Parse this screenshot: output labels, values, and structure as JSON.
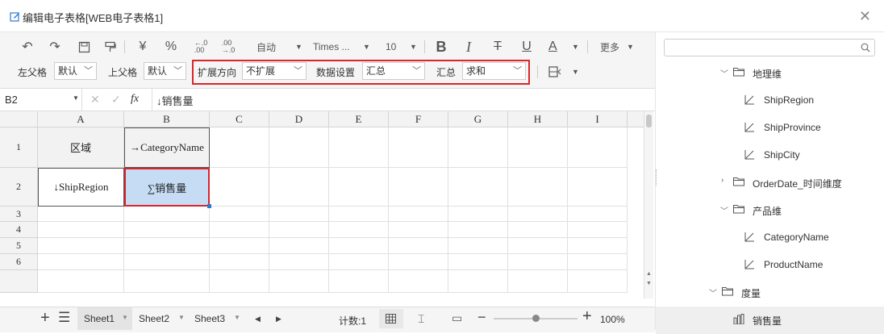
{
  "window": {
    "title": "编辑电子表格[WEB电子表格1]"
  },
  "toolbar": {
    "font_size": "10",
    "auto_label": "自动",
    "font_name": "Times ...",
    "currency": "¥",
    "percent": "%",
    "more_label": "更多",
    "left_parent_label": "左父格",
    "left_parent_value": "默认",
    "top_parent_label": "上父格",
    "top_parent_value": "默认",
    "expand_label": "扩展方向",
    "expand_value": "不扩展",
    "data_setting_label": "数据设置",
    "data_setting_value": "汇总",
    "summary_label": "汇总",
    "summary_value": "求和"
  },
  "formula_bar": {
    "cell_ref": "B2",
    "content": "↓销售量"
  },
  "grid": {
    "columns": [
      "A",
      "B",
      "C",
      "D",
      "E",
      "F",
      "G",
      "H",
      "I"
    ],
    "rows": [
      "1",
      "2",
      "3",
      "4",
      "5",
      "6"
    ],
    "cells": {
      "A1": "区域",
      "B1": "→CategoryName",
      "A2": "↓ShipRegion",
      "B2": "∑销售量"
    }
  },
  "sheets": [
    "Sheet1",
    "Sheet2",
    "Sheet3"
  ],
  "status": {
    "count": "计数:1",
    "zoom": "100%"
  },
  "search": {
    "placeholder": ""
  },
  "tree": [
    {
      "label": "地理维",
      "type": "folder",
      "level": 1,
      "expanded": true
    },
    {
      "label": "ShipRegion",
      "type": "field",
      "level": 2
    },
    {
      "label": "ShipProvince",
      "type": "field",
      "level": 2
    },
    {
      "label": "ShipCity",
      "type": "field",
      "level": 2
    },
    {
      "label": "OrderDate_时间维度",
      "type": "folder",
      "level": 1,
      "expanded": false
    },
    {
      "label": "产品维",
      "type": "folder",
      "level": 1,
      "expanded": true
    },
    {
      "label": "CategoryName",
      "type": "field",
      "level": 2
    },
    {
      "label": "ProductName",
      "type": "field",
      "level": 2
    },
    {
      "label": "度量",
      "type": "folder",
      "level": 0,
      "expanded": true
    },
    {
      "label": "销售量",
      "type": "measure",
      "level": 1
    }
  ],
  "colors": {
    "selection": "#c6dcf5",
    "highlight_border": "#d9252b",
    "accent": "#2a7ad2"
  }
}
